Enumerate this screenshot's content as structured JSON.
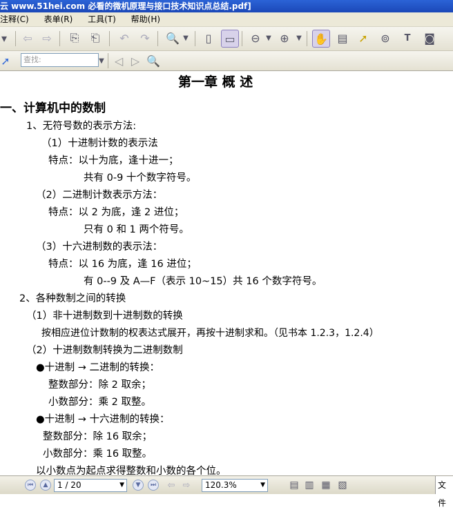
{
  "window": {
    "title": "云 www.51hei.com 必看的微机原理与接口技术知识点总结.pdf]"
  },
  "menu": {
    "items": [
      "注释(C)",
      "表单(R)",
      "工具(T)",
      "帮助(H)"
    ]
  },
  "toolbar2": {
    "search_placeholder": "查找:"
  },
  "document": {
    "chapter_title": "第一章    概  述",
    "section1_title": "一、计算机中的数制",
    "lines": [
      "1、无符号数的表示方法:",
      "（1）十进制计数的表示法",
      "特点：以十为底，逢十进一；",
      "共有 0-9 十个数字符号。",
      "（2）二进制计数表示方法：",
      "特点：以 2 为底，逢 2 进位；",
      "只有 0 和 1 两个符号。",
      "（3）十六进制数的表示法：",
      "特点：以 16 为底，逢 16 进位；",
      "有 0--9 及 A—F（表示 10~15）共 16 个数字符号。",
      "2、各种数制之间的转换",
      "（1）非十进制数到十进制数的转换",
      "按相应进位计数制的权表达式展开，再按十进制求和。（见书本 1.2.3，1.2.4）",
      "（2）十进制数制转换为二进制数制",
      "●十进制 → 二进制的转换：",
      "整数部分：除 2 取余；",
      "小数部分：乘 2 取整。",
      "●十进制 → 十六进制的转换：",
      "整数部分：除 16 取余；",
      "小数部分：乘 16 取整。",
      "以小数点为起点求得整数和小数的各个位。"
    ]
  },
  "statusbar": {
    "page_indicator": "1 / 20",
    "zoom": "120.3%",
    "right_label": "文件"
  }
}
